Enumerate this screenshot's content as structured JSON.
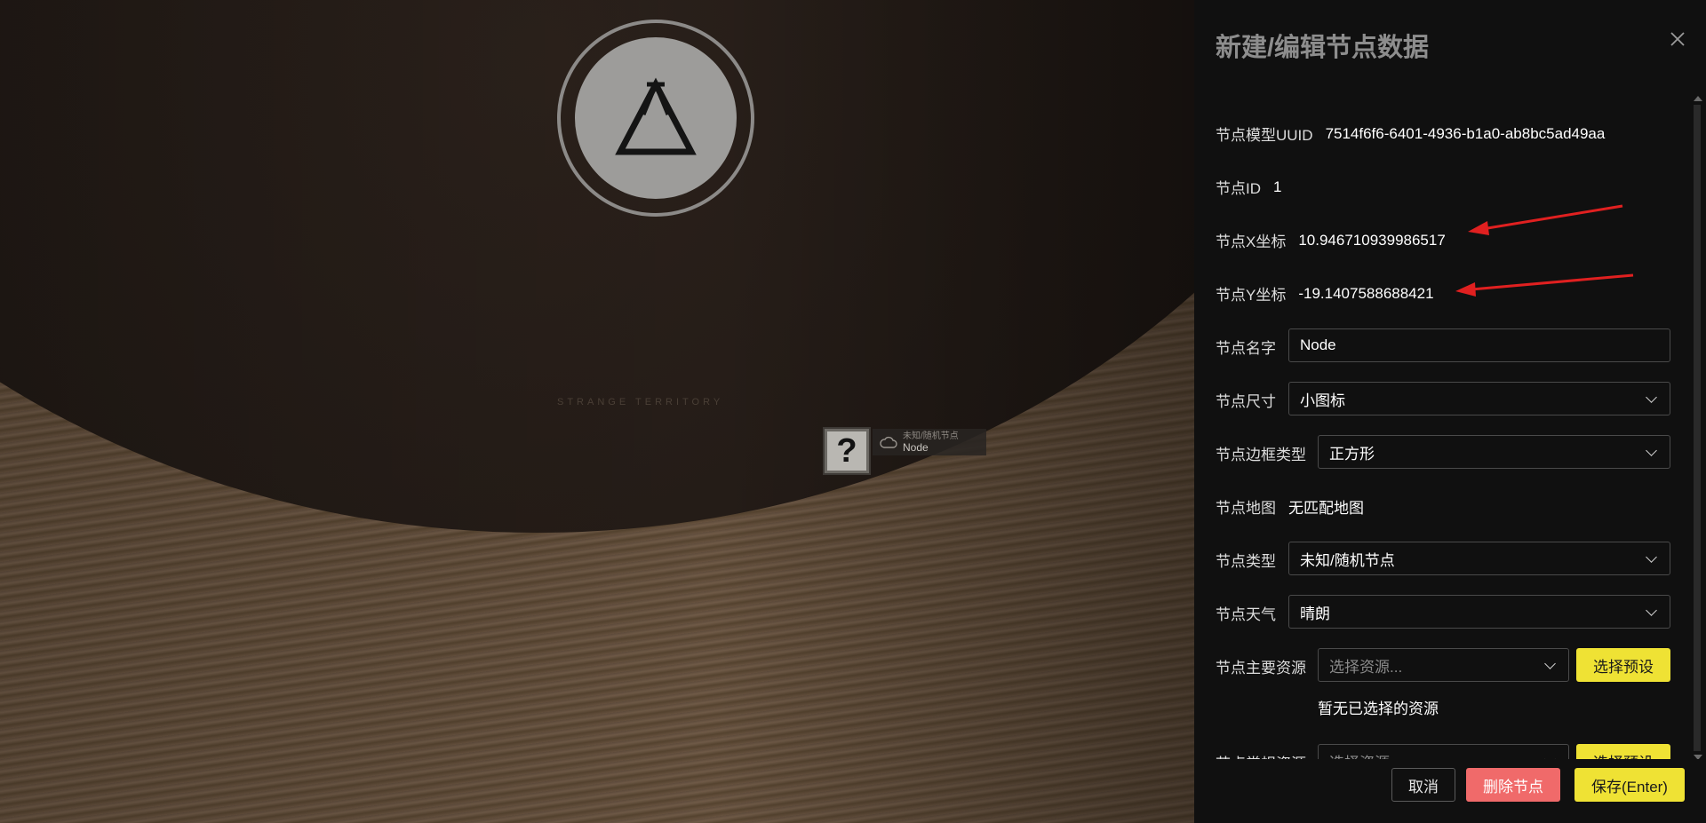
{
  "map": {
    "territory_text": "STRANGE TERRITORY",
    "node_marker": {
      "glyph": "?",
      "type_label": "未知/随机节点",
      "name_label": "Node",
      "icon": "cloud-icon"
    }
  },
  "panel": {
    "title": "新建/编辑节点数据",
    "close_icon": "close-icon",
    "uuid": {
      "label": "节点模型UUID",
      "value": "7514f6f6-6401-4936-b1a0-ab8bc5ad49aa"
    },
    "node_id": {
      "label": "节点ID",
      "value": "1"
    },
    "x": {
      "label": "节点X坐标",
      "value": "10.946710939986517"
    },
    "y": {
      "label": "节点Y坐标",
      "value": "-19.1407588688421"
    },
    "name": {
      "label": "节点名字",
      "value": "Node"
    },
    "size": {
      "label": "节点尺寸",
      "value": "小图标"
    },
    "border": {
      "label": "节点边框类型",
      "value": "正方形"
    },
    "map": {
      "label": "节点地图",
      "value": "无匹配地图"
    },
    "type": {
      "label": "节点类型",
      "value": "未知/随机节点"
    },
    "weather": {
      "label": "节点天气",
      "value": "晴朗"
    },
    "main_resource": {
      "label": "节点主要资源",
      "placeholder": "选择资源...",
      "button": "选择预设",
      "empty_text": "暂无已选择的资源"
    },
    "common_resource": {
      "label": "节点常规资源",
      "placeholder": "选择资源...",
      "button": "选择预设"
    },
    "footer": {
      "cancel": "取消",
      "delete": "删除节点",
      "save": "保存(Enter)"
    }
  },
  "colors": {
    "accent_yellow": "#efe234",
    "danger_red": "#f06a6a",
    "annotation_arrow": "#e02020"
  }
}
